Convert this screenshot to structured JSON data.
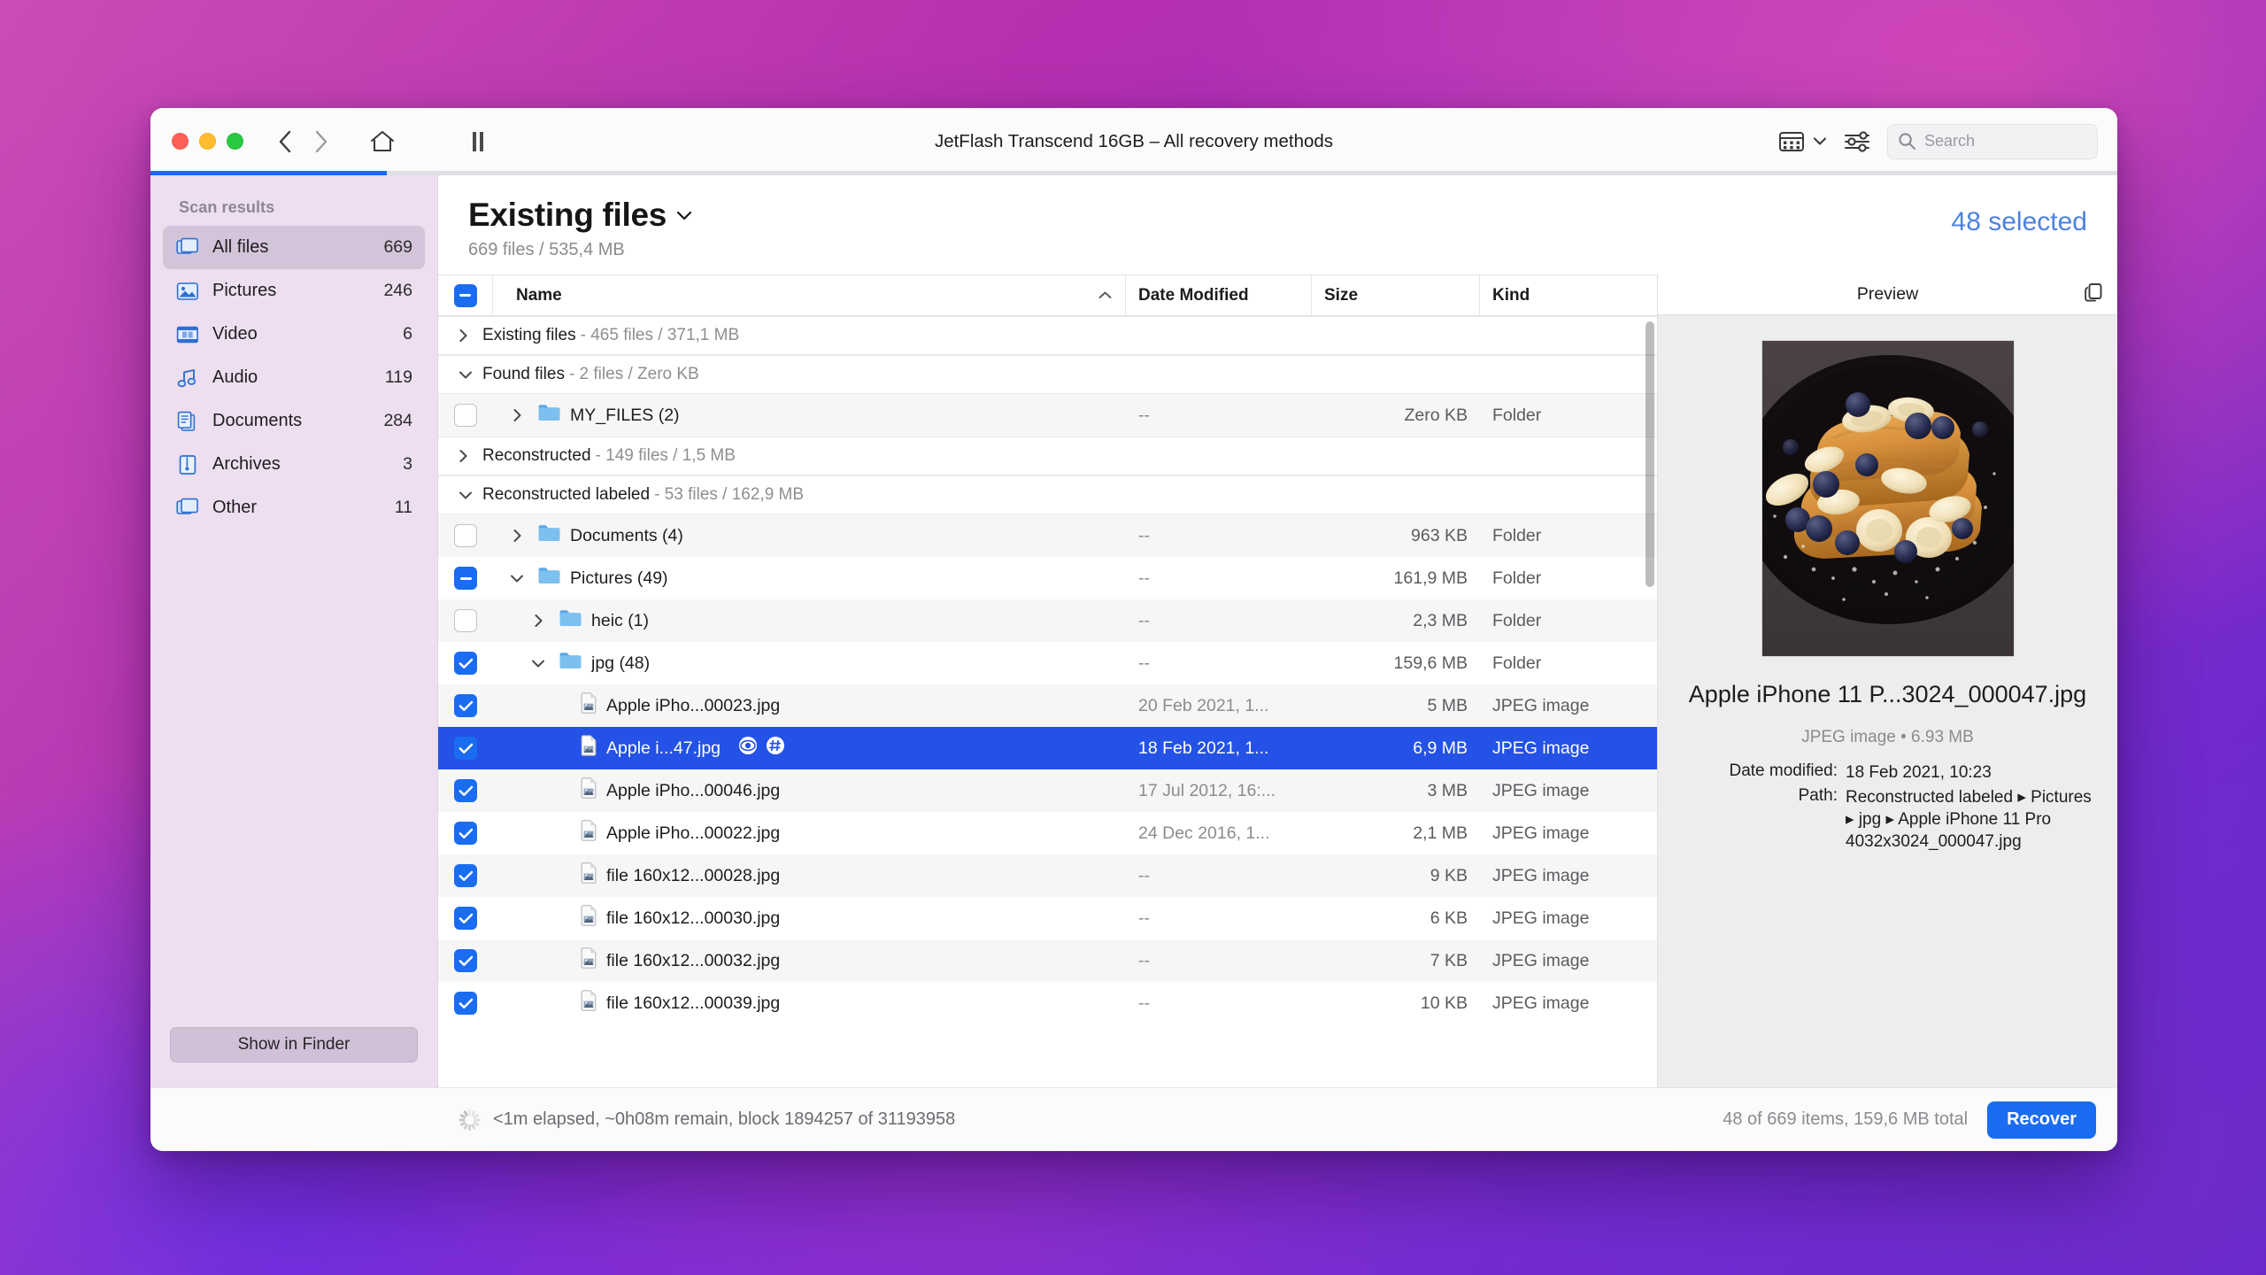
{
  "window": {
    "title": "JetFlash Transcend 16GB – All recovery methods",
    "traffic_lights": [
      "close",
      "minimize",
      "zoom"
    ],
    "progress_percent": 12,
    "toolbar": {
      "back_icon": "chevron-left-icon",
      "forward_icon": "chevron-right-icon",
      "home_icon": "home-icon",
      "pause_icon": "pause-icon",
      "view_icon": "view-options-icon",
      "view_chevron_icon": "chevron-down-icon",
      "filter_icon": "sliders-icon",
      "search_icon": "search-icon",
      "search_placeholder": "Search",
      "search_value": ""
    }
  },
  "sidebar": {
    "header": "Scan results",
    "items": [
      {
        "label": "All files",
        "count": "669",
        "icon": "all-files-icon",
        "active": true
      },
      {
        "label": "Pictures",
        "count": "246",
        "icon": "pictures-icon",
        "active": false
      },
      {
        "label": "Video",
        "count": "6",
        "icon": "video-icon",
        "active": false
      },
      {
        "label": "Audio",
        "count": "119",
        "icon": "audio-icon",
        "active": false
      },
      {
        "label": "Documents",
        "count": "284",
        "icon": "documents-icon",
        "active": false
      },
      {
        "label": "Archives",
        "count": "3",
        "icon": "archives-icon",
        "active": false
      },
      {
        "label": "Other",
        "count": "11",
        "icon": "other-icon",
        "active": false
      }
    ],
    "show_in_finder": "Show in Finder"
  },
  "main": {
    "title": "Existing files",
    "title_chevron_icon": "chevron-down-icon",
    "subtitle": "669 files / 535,4 MB",
    "selected_label": "48 selected",
    "columns": {
      "name": "Name",
      "sort_icon": "chevron-up-icon",
      "date_modified": "Date Modified",
      "size": "Size",
      "kind": "Kind"
    },
    "header_checkbox": "mixed",
    "rows": [
      {
        "type": "group",
        "expanded": false,
        "name": "Existing files",
        "meta": "- 465 files / 371,1 MB"
      },
      {
        "type": "group",
        "expanded": true,
        "name": "Found files",
        "meta": "- 2 files / Zero KB"
      },
      {
        "type": "file",
        "checkbox": "off",
        "indent": 1,
        "twisty": "collapsed",
        "icon": "folder-icon",
        "name": "MY_FILES (2)",
        "date": "--",
        "size": "Zero KB",
        "kind": "Folder",
        "selected": false,
        "alt": true
      },
      {
        "type": "group",
        "expanded": false,
        "name": "Reconstructed",
        "meta": "- 149 files / 1,5 MB"
      },
      {
        "type": "group",
        "expanded": true,
        "name": "Reconstructed labeled",
        "meta": "- 53 files / 162,9 MB"
      },
      {
        "type": "file",
        "checkbox": "off",
        "indent": 1,
        "twisty": "collapsed",
        "icon": "folder-icon",
        "name": "Documents (4)",
        "date": "--",
        "size": "963 KB",
        "kind": "Folder",
        "selected": false,
        "alt": true
      },
      {
        "type": "file",
        "checkbox": "mixed",
        "indent": 1,
        "twisty": "expanded",
        "icon": "folder-icon",
        "name": "Pictures (49)",
        "date": "--",
        "size": "161,9 MB",
        "kind": "Folder",
        "selected": false,
        "alt": false
      },
      {
        "type": "file",
        "checkbox": "off",
        "indent": 2,
        "twisty": "collapsed",
        "icon": "folder-icon",
        "name": "heic (1)",
        "date": "--",
        "size": "2,3 MB",
        "kind": "Folder",
        "selected": false,
        "alt": true
      },
      {
        "type": "file",
        "checkbox": "on",
        "indent": 2,
        "twisty": "expanded",
        "icon": "folder-icon",
        "name": "jpg (48)",
        "date": "--",
        "size": "159,6 MB",
        "kind": "Folder",
        "selected": false,
        "alt": false
      },
      {
        "type": "file",
        "checkbox": "on",
        "indent": 3,
        "twisty": "none",
        "icon": "jpeg-file-icon",
        "name": "Apple iPho...00023.jpg",
        "date": "20 Feb 2021, 1...",
        "size": "5 MB",
        "kind": "JPEG image",
        "selected": false,
        "alt": true
      },
      {
        "type": "file",
        "checkbox": "on",
        "indent": 3,
        "twisty": "none",
        "icon": "jpeg-file-icon",
        "name": "Apple i...47.jpg",
        "date": "18 Feb 2021, 1...",
        "size": "6,9 MB",
        "kind": "JPEG image",
        "selected": true,
        "alt": false,
        "row_icons": [
          "eye-icon",
          "hash-icon"
        ]
      },
      {
        "type": "file",
        "checkbox": "on",
        "indent": 3,
        "twisty": "none",
        "icon": "jpeg-file-icon",
        "name": "Apple iPho...00046.jpg",
        "date": "17 Jul 2012, 16:...",
        "size": "3 MB",
        "kind": "JPEG image",
        "selected": false,
        "alt": true
      },
      {
        "type": "file",
        "checkbox": "on",
        "indent": 3,
        "twisty": "none",
        "icon": "jpeg-file-icon",
        "name": "Apple iPho...00022.jpg",
        "date": "24 Dec 2016, 1...",
        "size": "2,1 MB",
        "kind": "JPEG image",
        "selected": false,
        "alt": false
      },
      {
        "type": "file",
        "checkbox": "on",
        "indent": 3,
        "twisty": "none",
        "icon": "jpeg-file-icon",
        "name": "file 160x12...00028.jpg",
        "date": "--",
        "size": "9 KB",
        "kind": "JPEG image",
        "selected": false,
        "alt": true
      },
      {
        "type": "file",
        "checkbox": "on",
        "indent": 3,
        "twisty": "none",
        "icon": "jpeg-file-icon",
        "name": "file 160x12...00030.jpg",
        "date": "--",
        "size": "6 KB",
        "kind": "JPEG image",
        "selected": false,
        "alt": false
      },
      {
        "type": "file",
        "checkbox": "on",
        "indent": 3,
        "twisty": "none",
        "icon": "jpeg-file-icon",
        "name": "file 160x12...00032.jpg",
        "date": "--",
        "size": "7 KB",
        "kind": "JPEG image",
        "selected": false,
        "alt": true
      },
      {
        "type": "file",
        "checkbox": "on",
        "indent": 3,
        "twisty": "none",
        "icon": "jpeg-file-icon",
        "name": "file 160x12...00039.jpg",
        "date": "--",
        "size": "10 KB",
        "kind": "JPEG image",
        "selected": false,
        "alt": false
      }
    ]
  },
  "preview": {
    "header": "Preview",
    "copy_icon": "copy-icon",
    "image_alt": "french-toast-with-blueberries-and-bananas",
    "filename": "Apple iPhone 11 P...3024_000047.jpg",
    "type_and_size": "JPEG image • 6.93 MB",
    "fields": [
      {
        "key": "Date modified:",
        "value": "18 Feb 2021, 10:23"
      },
      {
        "key": "Path:",
        "value": "Reconstructed labeled ▸ Pictures ▸ jpg ▸ Apple iPhone 11 Pro 4032x3024_000047.jpg"
      }
    ]
  },
  "footer": {
    "spinner_icon": "spinner-icon",
    "status": "<1m elapsed, ~0h08m remain, block 1894257 of 31193958",
    "count": "48 of 669 items, 159,6 MB total",
    "recover_label": "Recover"
  },
  "colors": {
    "accent_blue": "#1a6cf0",
    "selection_blue": "#2452e6",
    "selected_text_blue": "#4d82df",
    "sidebar_bg": "#eddef0"
  }
}
